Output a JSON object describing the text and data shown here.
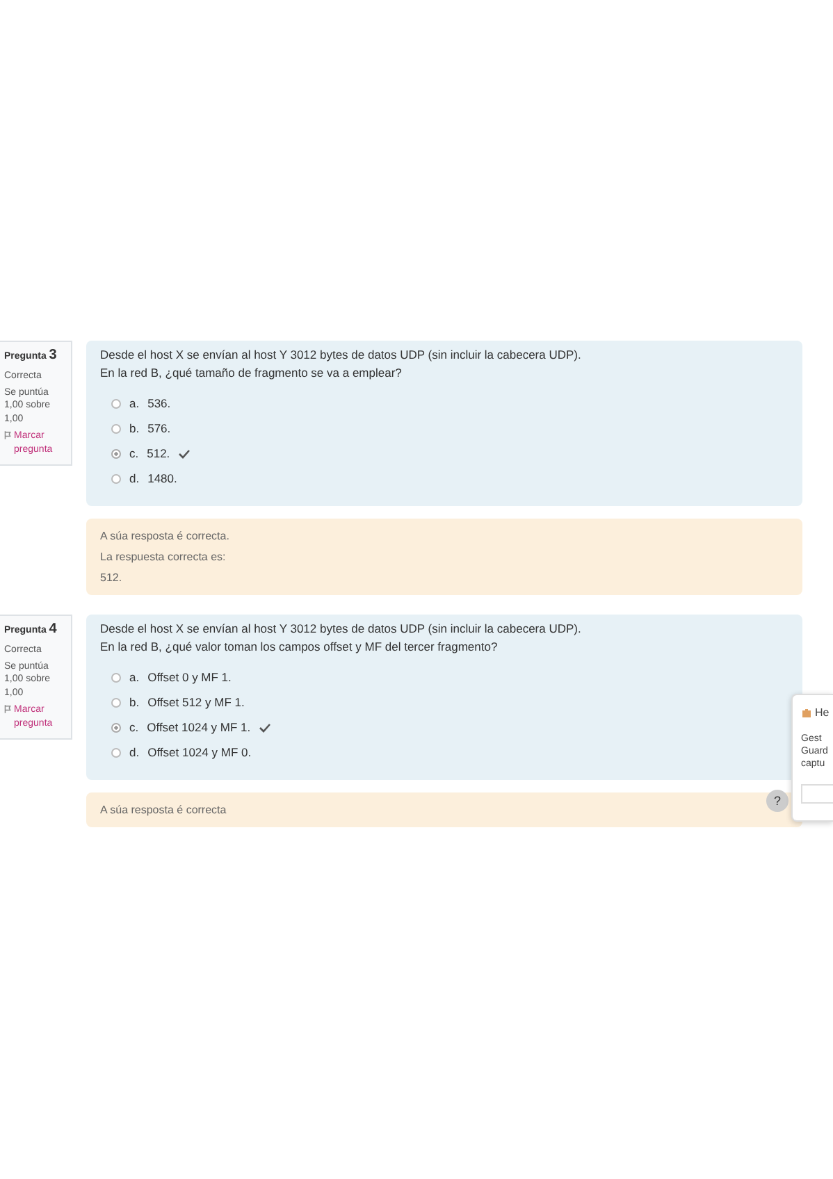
{
  "questions": [
    {
      "number_label": "Pregunta",
      "number": "3",
      "status": "Correcta",
      "score": "Se puntúa 1,00 sobre 1,00",
      "flag": "Marcar pregunta",
      "text": [
        "Desde el host X se envían al host Y 3012 bytes de datos UDP (sin incluir la cabecera UDP).",
        "En la red B, ¿qué tamaño de fragmento se va a emplear?"
      ],
      "options": [
        {
          "letter": "a.",
          "text": "536.",
          "selected": false,
          "correct": false
        },
        {
          "letter": "b.",
          "text": "576.",
          "selected": false,
          "correct": false
        },
        {
          "letter": "c.",
          "text": "512.",
          "selected": true,
          "correct": true
        },
        {
          "letter": "d.",
          "text": "1480.",
          "selected": false,
          "correct": false
        }
      ],
      "feedback": [
        "A súa resposta é correcta.",
        "La respuesta correcta es:",
        "512."
      ]
    },
    {
      "number_label": "Pregunta",
      "number": "4",
      "status": "Correcta",
      "score": "Se puntúa 1,00 sobre 1,00",
      "flag": "Marcar pregunta",
      "text": [
        "Desde el host X se envían al host Y 3012 bytes de datos UDP (sin incluir la cabecera UDP).",
        "En la red B, ¿qué valor toman los campos offset y MF del tercer fragmento?"
      ],
      "options": [
        {
          "letter": "a.",
          "text": "Offset 0 y MF 1.",
          "selected": false,
          "correct": false
        },
        {
          "letter": "b.",
          "text": "Offset 512 y MF 1.",
          "selected": false,
          "correct": false
        },
        {
          "letter": "c.",
          "text": "Offset 1024 y MF 1.",
          "selected": true,
          "correct": true
        },
        {
          "letter": "d.",
          "text": "Offset 1024 y MF 0.",
          "selected": false,
          "correct": false
        }
      ],
      "feedback": [
        "A súa resposta é correcta"
      ]
    }
  ],
  "help_button": "?",
  "popup": {
    "title": "He",
    "lines": [
      "Gest",
      "Guard",
      "captu"
    ]
  }
}
